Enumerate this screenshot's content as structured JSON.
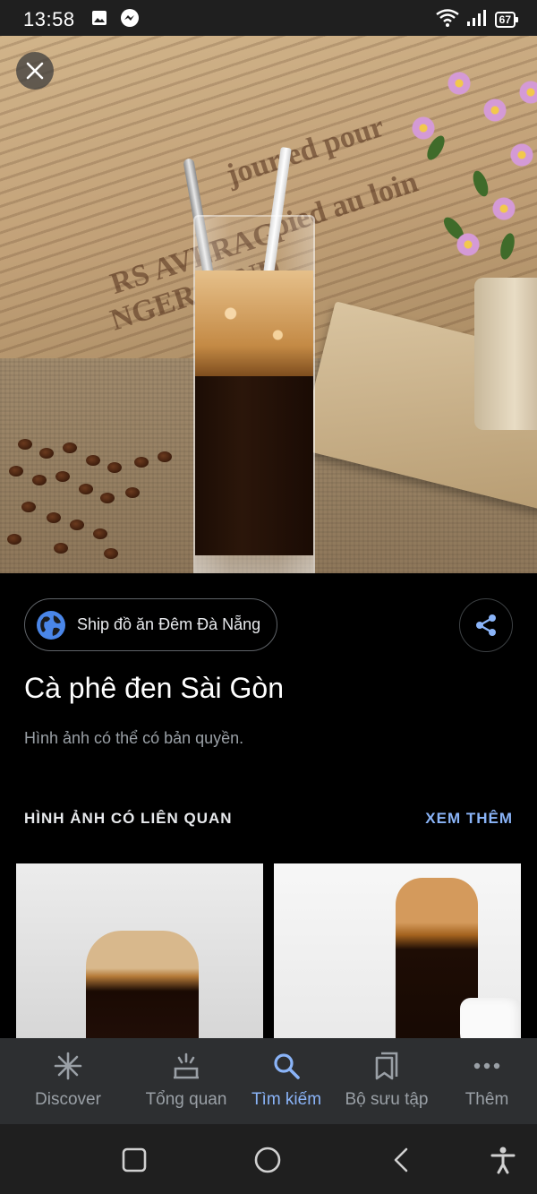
{
  "status_bar": {
    "time": "13:58",
    "battery": "67",
    "icons": [
      "gallery-icon",
      "messenger-icon",
      "wifi-icon",
      "signal-icon",
      "battery-icon"
    ]
  },
  "hero": {
    "description_icons": [
      "close-icon"
    ]
  },
  "source": {
    "label": "Ship đồ ăn Đêm Đà Nẵng",
    "icon": "globe-icon"
  },
  "title": "Cà phê đen Sài Gòn",
  "copyright": "Hình ảnh có thể có bản quyền.",
  "related": {
    "header": "HÌNH ẢNH CÓ LIÊN QUAN",
    "see_more": "XEM THÊM"
  },
  "bottom_nav": {
    "items": [
      {
        "label": "Discover",
        "icon": "asterisk-icon",
        "active": false
      },
      {
        "label": "Tổng quan",
        "icon": "overview-icon",
        "active": false
      },
      {
        "label": "Tìm kiếm",
        "icon": "search-icon",
        "active": true
      },
      {
        "label": "Bộ sưu tập",
        "icon": "collections-icon",
        "active": false
      },
      {
        "label": "Thêm",
        "icon": "more-icon",
        "active": false
      }
    ]
  },
  "colors": {
    "accent": "#8ab4f8",
    "background": "#000000",
    "nav_background": "#2d2f31",
    "muted_text": "#9aa0a6"
  }
}
